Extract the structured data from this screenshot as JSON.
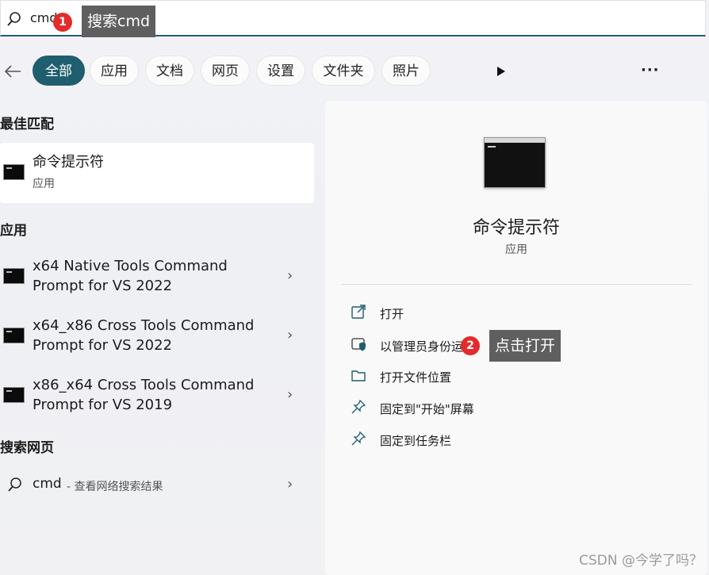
{
  "search": {
    "query": "cmd"
  },
  "annotations": [
    {
      "number": "1",
      "label": "搜索cmd"
    },
    {
      "number": "2",
      "label": "点击打开"
    }
  ],
  "filters": [
    "全部",
    "应用",
    "文档",
    "网页",
    "设置",
    "文件夹",
    "照片"
  ],
  "sections": {
    "best_match": "最佳匹配",
    "apps": "应用",
    "web": "搜索网页"
  },
  "best_match": {
    "title": "命令提示符",
    "subtitle": "应用"
  },
  "apps": [
    {
      "line1": "x64 Native Tools Command",
      "line2": "Prompt for VS 2022"
    },
    {
      "line1": "x64_x86 Cross Tools Command",
      "line2": "Prompt for VS 2022"
    },
    {
      "line1": "x86_x64 Cross Tools Command",
      "line2": "Prompt for VS 2019"
    }
  ],
  "web_result": {
    "query": "cmd",
    "suffix": " - 查看网络搜索结果"
  },
  "detail": {
    "title": "命令提示符",
    "subtitle": "应用",
    "actions": [
      "打开",
      "以管理员身份运",
      "打开文件位置",
      "固定到\"开始\"屏幕",
      "固定到任务栏"
    ]
  },
  "watermark": "CSDN @今学了吗？",
  "colors": {
    "accent": "#1f5e6e",
    "badge": "#e32b2b",
    "tooltip": "#5f5f5f"
  }
}
